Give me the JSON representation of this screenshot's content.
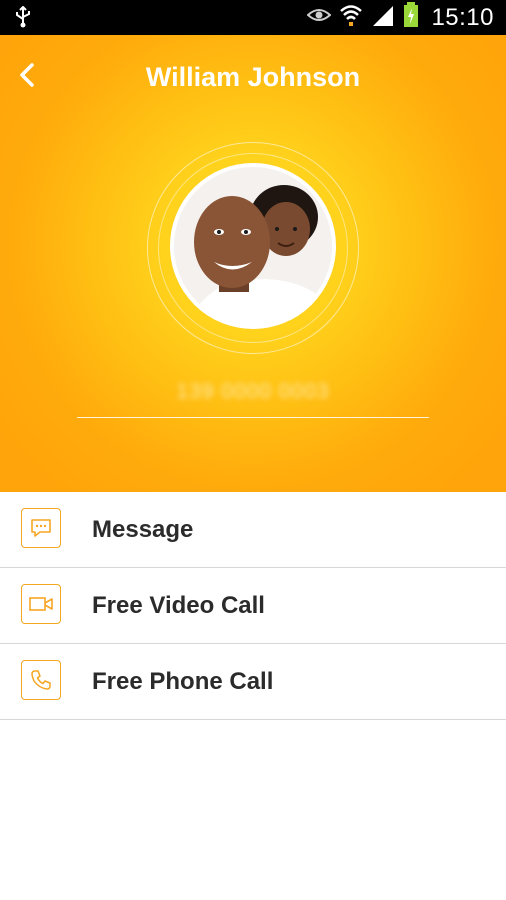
{
  "status_bar": {
    "time": "15:10",
    "icons": [
      "usb-icon",
      "eye-icon",
      "wifi-icon",
      "signal-icon",
      "battery-icon"
    ]
  },
  "header": {
    "title": "William Johnson",
    "phone_number": "139 0000 0003",
    "back_icon": "back-arrow-icon",
    "accent_color": "#ffa40a"
  },
  "actions": [
    {
      "label": "Message",
      "icon": "message-icon"
    },
    {
      "label": "Free Video Call",
      "icon": "video-camera-icon"
    },
    {
      "label": "Free Phone Call",
      "icon": "phone-icon"
    }
  ],
  "icon_color": "#f5a623"
}
